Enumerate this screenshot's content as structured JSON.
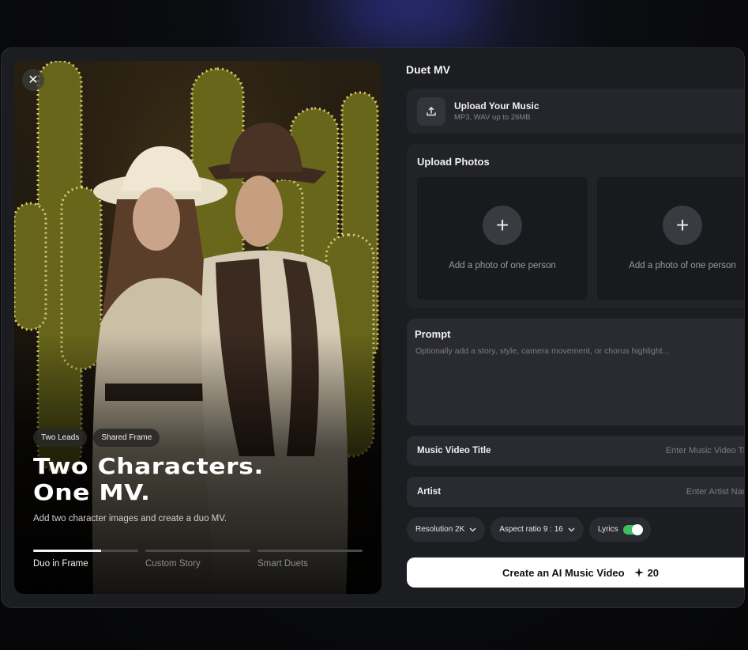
{
  "preview": {
    "tags": [
      "Two Leads",
      "Shared Frame"
    ],
    "headline_line1": "Two Characters.",
    "headline_line2": "One MV.",
    "subtext": "Add two character images and create a duo MV.",
    "steps": [
      {
        "label": "Duo in Frame",
        "progress": 0.65,
        "active": true
      },
      {
        "label": "Custom Story",
        "progress": 0,
        "active": false
      },
      {
        "label": "Smart Duets",
        "progress": 0,
        "active": false
      }
    ]
  },
  "panel": {
    "title": "Duet MV",
    "upload_music": {
      "title": "Upload Your Music",
      "hint": "MP3, WAV up to 26MB",
      "icon": "upload-icon"
    },
    "upload_photos": {
      "title": "Upload Photos",
      "slots": [
        "Add a photo of one person",
        "Add a photo of one person"
      ]
    },
    "prompt": {
      "title": "Prompt",
      "placeholder": "Optionally add a story, style, camera movement, or chorus highlight..."
    },
    "title_field": {
      "label": "Music Video Title",
      "placeholder": "Enter Music Video Title"
    },
    "artist_field": {
      "label": "Artist",
      "placeholder": "Enter Artist Name"
    },
    "options": {
      "resolution": "Resolution 2K",
      "aspect_ratio": "Aspect ratio 9 : 16",
      "lyrics": "Lyrics",
      "lyrics_enabled": true
    },
    "create_button": {
      "label": "Create an AI Music Video",
      "credits": "20"
    }
  },
  "colors": {
    "accent_toggle": "#3fbf5d",
    "panel_bg": "#1c1d21"
  }
}
